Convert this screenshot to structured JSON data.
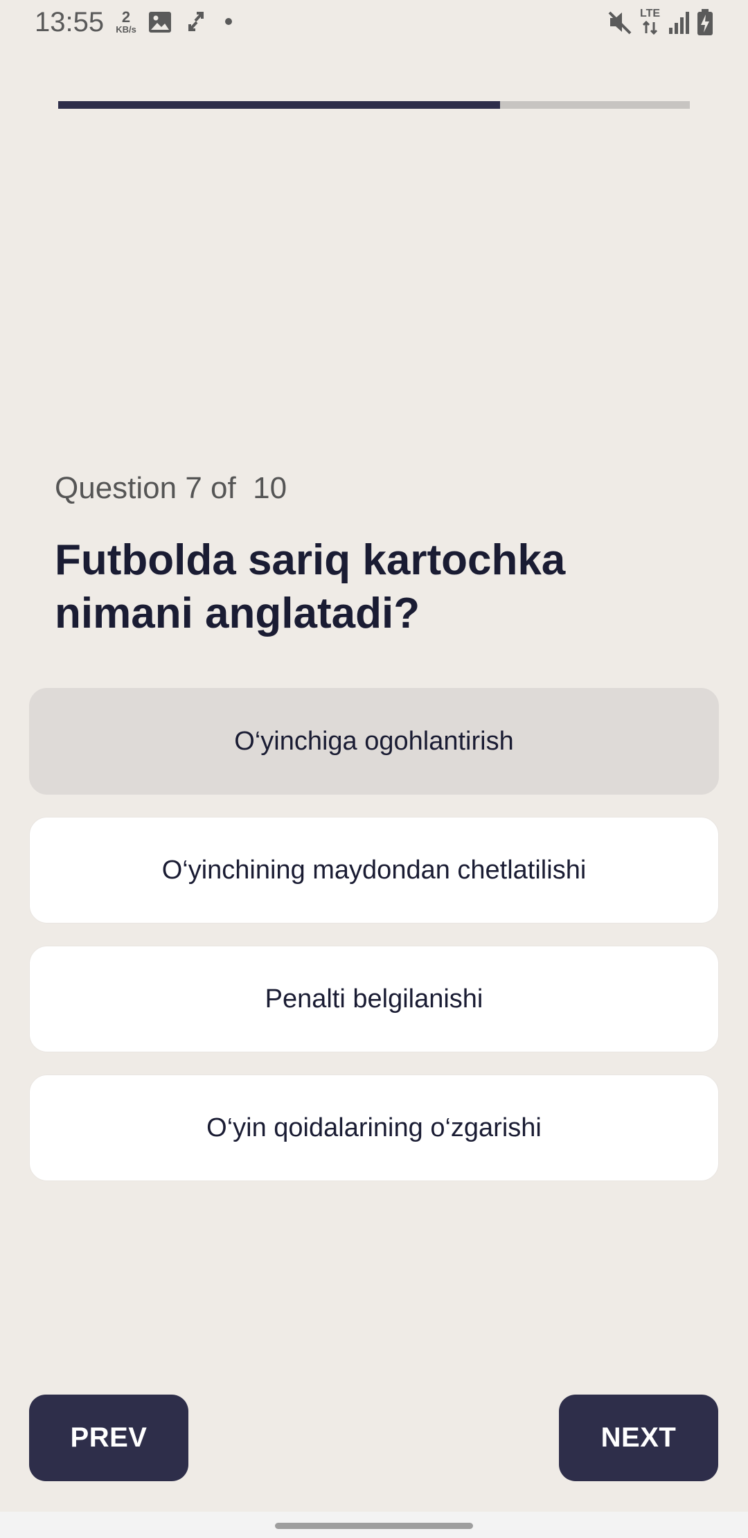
{
  "status_bar": {
    "time": "13:55",
    "net_speed_value": "2",
    "net_speed_unit": "KB/s",
    "network_type": "LTE",
    "icons": [
      "image-icon",
      "sync-icon",
      "dot-icon",
      "mute-icon",
      "lte-icon",
      "signal-icon",
      "battery-charging-icon"
    ]
  },
  "progress": {
    "current": 7,
    "total": 10,
    "fraction": 0.7
  },
  "question": {
    "counter_label": "Question 7 of  10",
    "text": "Futbolda sariq kartochka nimani anglatadi?"
  },
  "options": [
    {
      "label": "O‘yinchiga ogohlantirish",
      "selected": true
    },
    {
      "label": "O‘yinchining maydondan chetlatilishi",
      "selected": false
    },
    {
      "label": "Penalti belgilanishi",
      "selected": false
    },
    {
      "label": "O‘yin qoidalarining o‘zgarishi",
      "selected": false
    }
  ],
  "navigation": {
    "prev_label": "PREV",
    "next_label": "NEXT"
  },
  "colors": {
    "background": "#efebe6",
    "accent": "#2e2e4a",
    "option_bg": "#ffffff",
    "option_selected_bg": "#dedad7",
    "progress_track": "#c7c4c1"
  }
}
